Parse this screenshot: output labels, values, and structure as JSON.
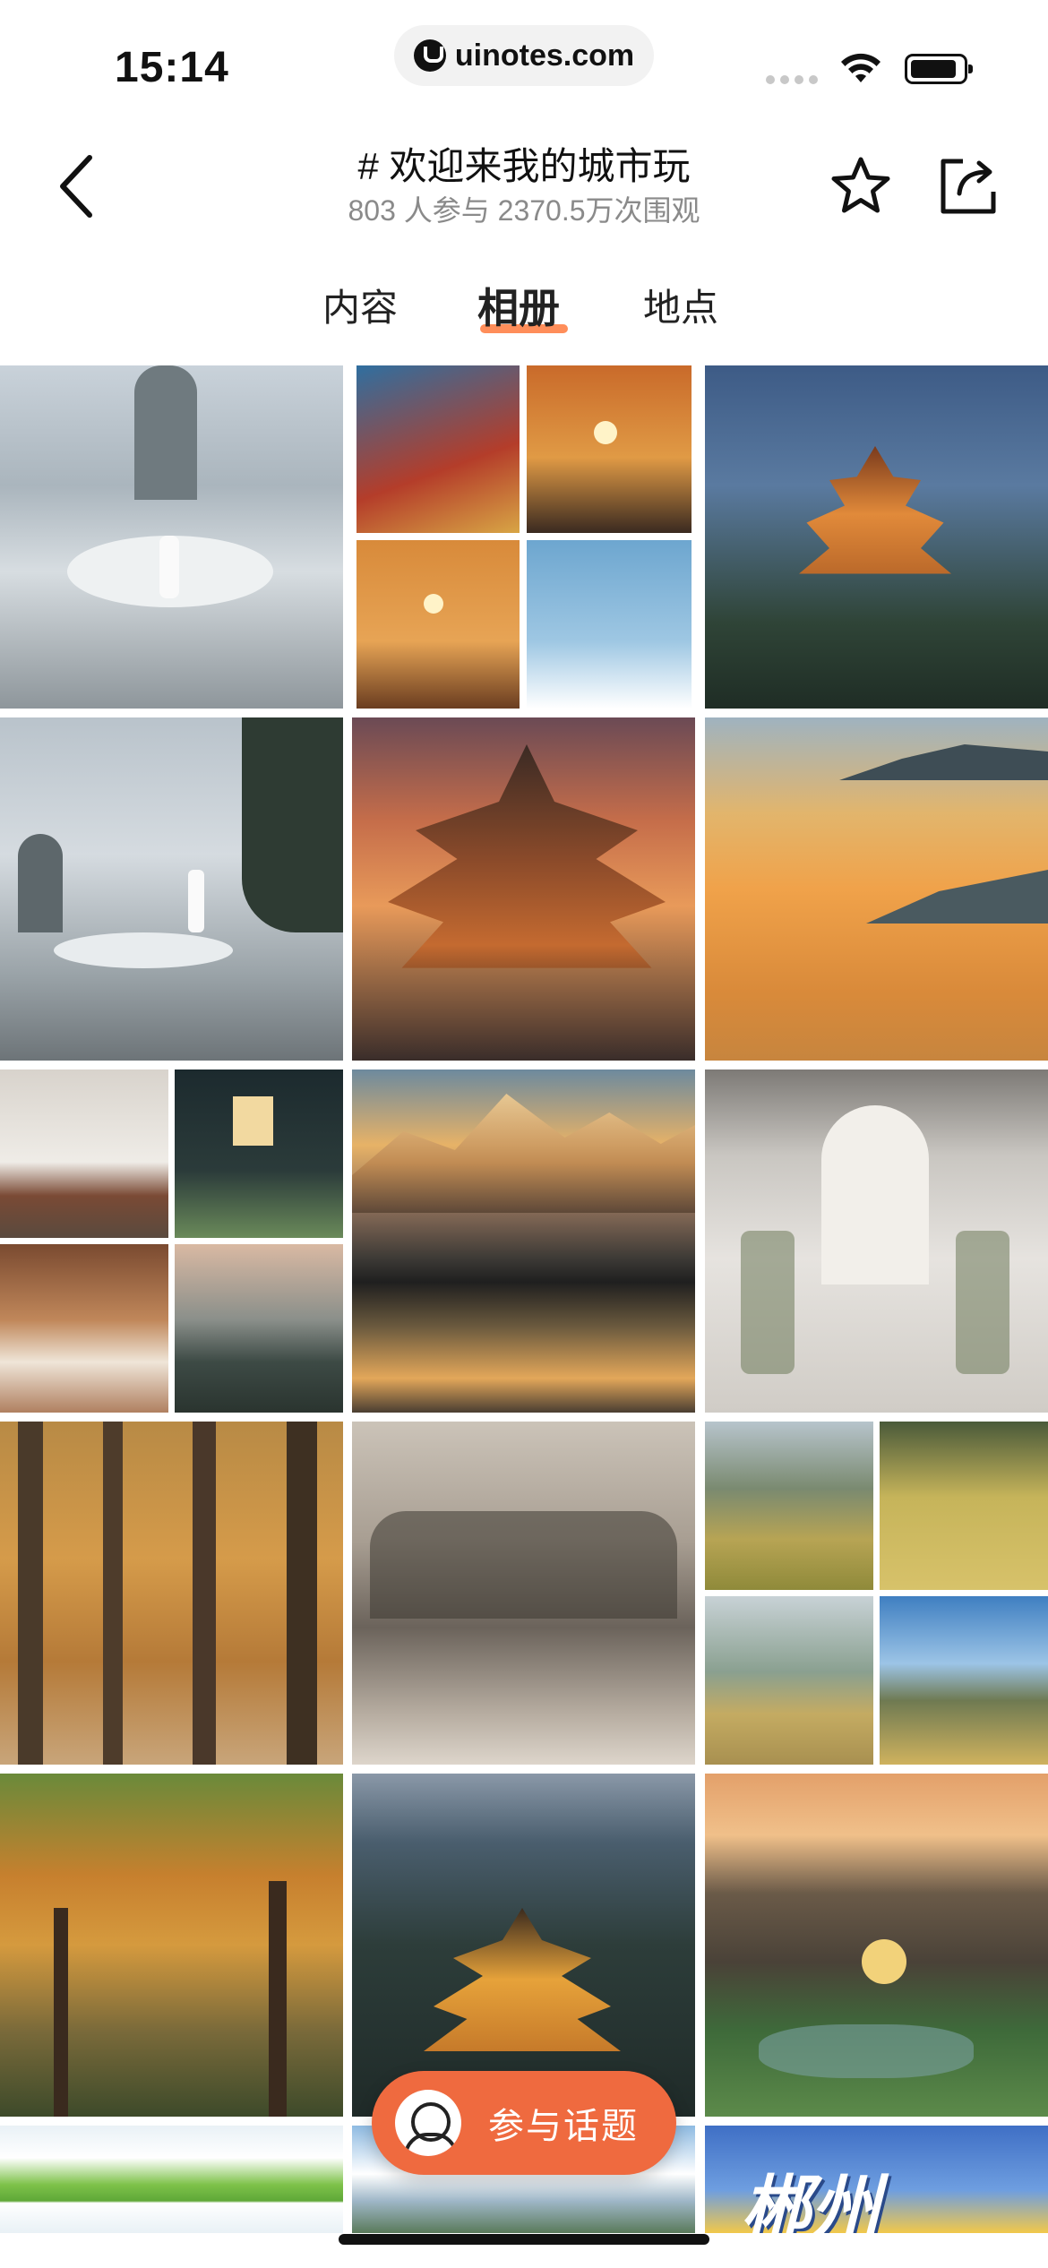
{
  "status_bar": {
    "time": "15:14",
    "url": "uinotes.com"
  },
  "header": {
    "title": "# 欢迎来我的城市玩",
    "subtitle": "803 人参与 2370.5万次围观"
  },
  "tabs": [
    {
      "label": "内容",
      "active": false
    },
    {
      "label": "相册",
      "active": true
    },
    {
      "label": "地点",
      "active": false
    }
  ],
  "grid_tiles": [
    {
      "name": "misty-lotus-platform-photo"
    },
    {
      "name": "temple-sunset-collage-photo"
    },
    {
      "name": "illuminated-pagoda-photo"
    },
    {
      "name": "woman-on-lotus-pond-photo"
    },
    {
      "name": "pagoda-at-sunset-photo"
    },
    {
      "name": "golden-lake-sunset-photo"
    },
    {
      "name": "hotel-dining-collage-photo"
    },
    {
      "name": "snow-mountain-reflection-photo"
    },
    {
      "name": "wedding-hall-photo"
    },
    {
      "name": "cypress-forest-photo"
    },
    {
      "name": "misty-village-photo"
    },
    {
      "name": "wheat-field-collage-photo"
    },
    {
      "name": "autumn-forest-photo"
    },
    {
      "name": "city-night-pagoda-photo"
    },
    {
      "name": "garden-temple-photo"
    },
    {
      "name": "green-meadow-photo"
    },
    {
      "name": "blue-sky-hills-photo"
    },
    {
      "name": "chenzhou-poster-photo",
      "overlay_text": "郴州"
    }
  ],
  "fab": {
    "label": "参与话题"
  },
  "colors": {
    "accent": "#ef6a3f",
    "tab_underline": "#ff7a3d",
    "subtitle": "#8a8a8a"
  }
}
